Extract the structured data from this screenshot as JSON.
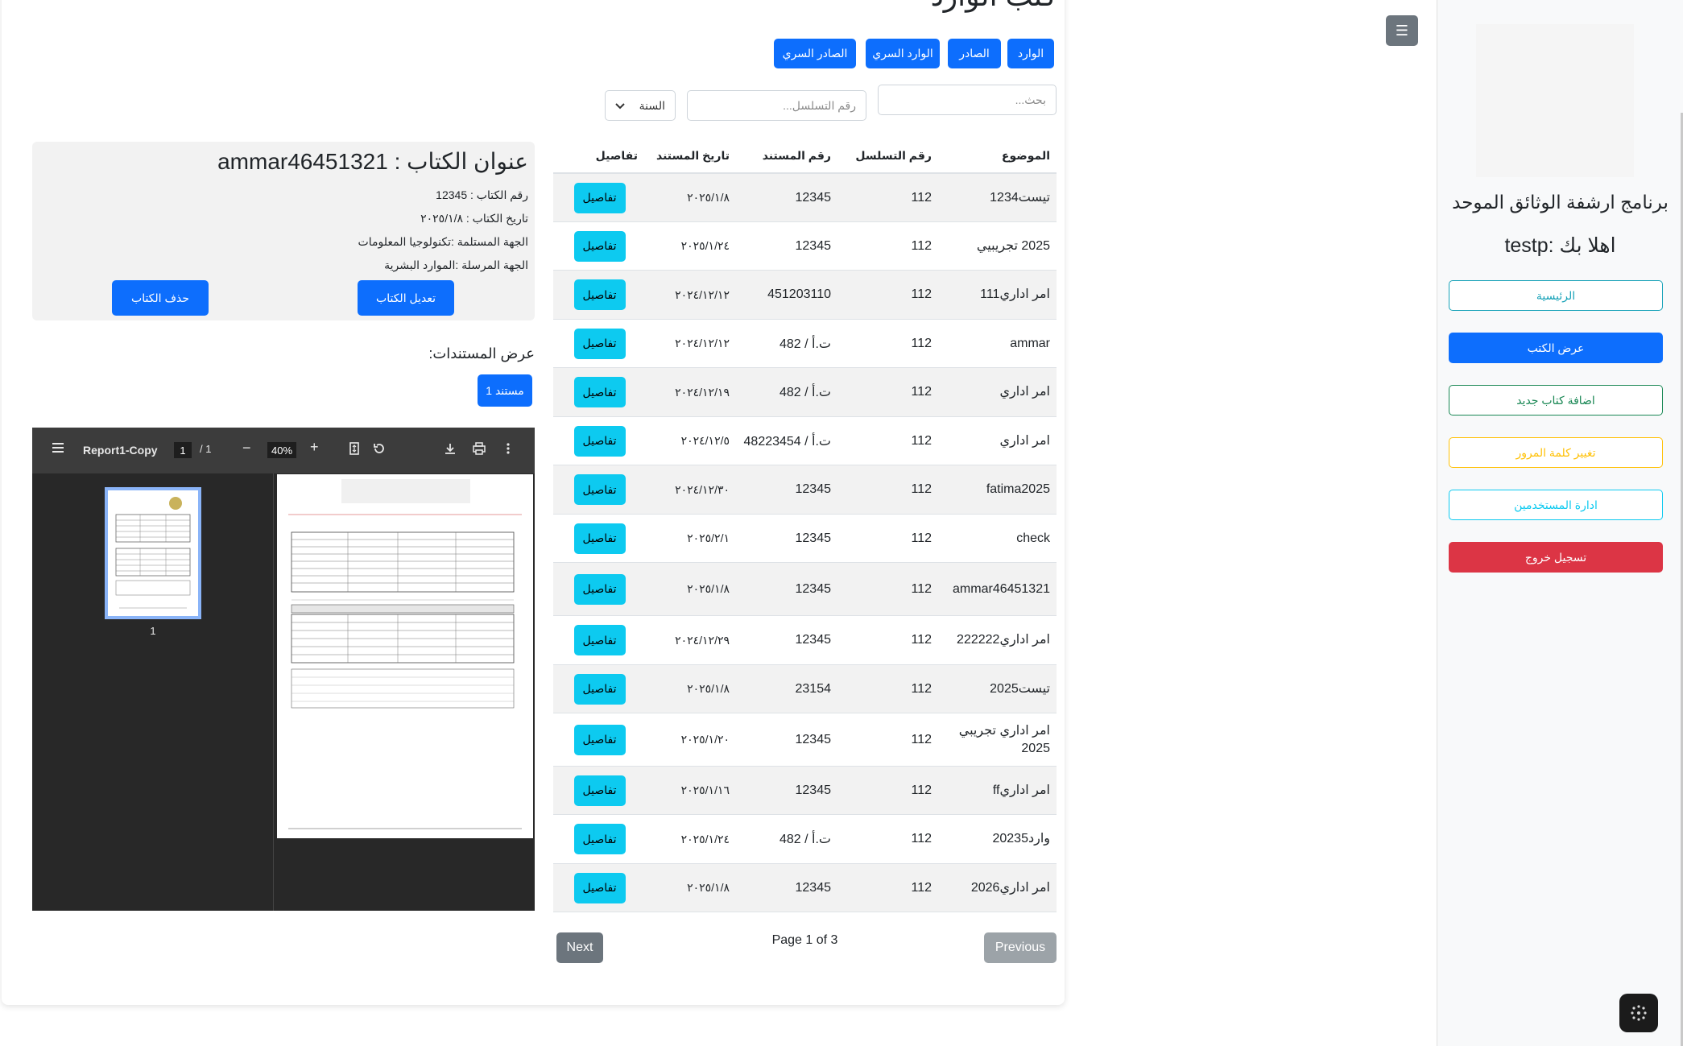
{
  "sidebar": {
    "app_title": "برنامج ارشفة الوثائق الموحد",
    "welcome": "اهلا بك :testp",
    "items": [
      {
        "label": "الرئيسية"
      },
      {
        "label": "عرض الكتب"
      },
      {
        "label": "اضافة كتاب جديد"
      },
      {
        "label": "تغيير كلمة المرور"
      },
      {
        "label": "ادارة المستخدمين"
      },
      {
        "label": "تسجيل خروج"
      }
    ],
    "toggle_icon": "☰"
  },
  "main": {
    "title": "كتب الوارد",
    "tabs": [
      {
        "label": "الوارد"
      },
      {
        "label": "الصادر"
      },
      {
        "label": "الوارد السري"
      },
      {
        "label": "الصادر السري"
      }
    ],
    "search_placeholder": "بحث...",
    "serial_placeholder": "رقم التسلسل...",
    "year_select": "السنة"
  },
  "table": {
    "headers": {
      "subject": "الموضوع",
      "serial": "رقم التسلسل",
      "doc_number": "رقم المستند",
      "doc_date": "تاريخ المستند",
      "details": "تفاصيل"
    },
    "details_label": "تفاصيل",
    "rows": [
      {
        "subject": "تيست1234",
        "serial": "112",
        "doc_number": "12345",
        "date": "٢٠٢٥/١/٨"
      },
      {
        "subject": "2025 تجريبيي",
        "serial": "112",
        "doc_number": "12345",
        "date": "٢٠٢٥/١/٢٤"
      },
      {
        "subject": "امر اداري111",
        "serial": "112",
        "doc_number": "451203110",
        "date": "٢٠٢٤/١٢/١٢"
      },
      {
        "subject": "ammar",
        "serial": "112",
        "doc_number": "ت.أ / 482",
        "date": "٢٠٢٤/١٢/١٢"
      },
      {
        "subject": "امر اداري",
        "serial": "112",
        "doc_number": "ت.أ / 482",
        "date": "٢٠٢٤/١٢/١٩"
      },
      {
        "subject": "امر اداري",
        "serial": "112",
        "doc_number": "ت.أ / 48223454",
        "date": "٢٠٢٤/١٢/٥"
      },
      {
        "subject": "fatima2025",
        "serial": "112",
        "doc_number": "12345",
        "date": "٢٠٢٤/١٢/٣٠"
      },
      {
        "subject": "check",
        "serial": "112",
        "doc_number": "12345",
        "date": "٢٠٢٥/٢/١"
      },
      {
        "subject": "ammar46451321",
        "serial": "112",
        "doc_number": "12345",
        "date": "٢٠٢٥/١/٨"
      },
      {
        "subject": "امر اداري222222",
        "serial": "112",
        "doc_number": "12345",
        "date": "٢٠٢٤/١٢/٢٩"
      },
      {
        "subject": "تيست2025",
        "serial": "112",
        "doc_number": "23154",
        "date": "٢٠٢٥/١/٨"
      },
      {
        "subject": "امر اداري تجريبي 2025",
        "serial": "112",
        "doc_number": "12345",
        "date": "٢٠٢٥/١/٢٠"
      },
      {
        "subject": "امر اداريff",
        "serial": "112",
        "doc_number": "12345",
        "date": "٢٠٢٥/١/١٦"
      },
      {
        "subject": "وارد20235",
        "serial": "112",
        "doc_number": "ت.أ / 482",
        "date": "٢٠٢٥/١/٢٤"
      },
      {
        "subject": "امر اداري2026",
        "serial": "112",
        "doc_number": "12345",
        "date": "٢٠٢٥/١/٨"
      }
    ]
  },
  "pagination": {
    "previous": "Previous",
    "next": "Next",
    "info": "Page 1 of 3"
  },
  "details": {
    "title": "عنوان الكتاب : ammar46451321",
    "book_number": "رقم الكتاب : 12345",
    "book_date": "تاريخ الكتاب : ٢٠٢٥/١/٨",
    "receiver": "الجهة المستلمة :تكنولوجيا المعلومات",
    "sender": "الجهة المرسلة :الموارد البشرية",
    "edit_label": "تعديل الكتاب",
    "delete_label": "حذف الكتاب",
    "docs_label": "عرض المستندات:",
    "doc_button": "مستند 1"
  },
  "pdf": {
    "file_name": "Report1-Copy",
    "current_page": "1",
    "page_of": "/  1",
    "zoom": "40%",
    "thumb_number": "1"
  }
}
